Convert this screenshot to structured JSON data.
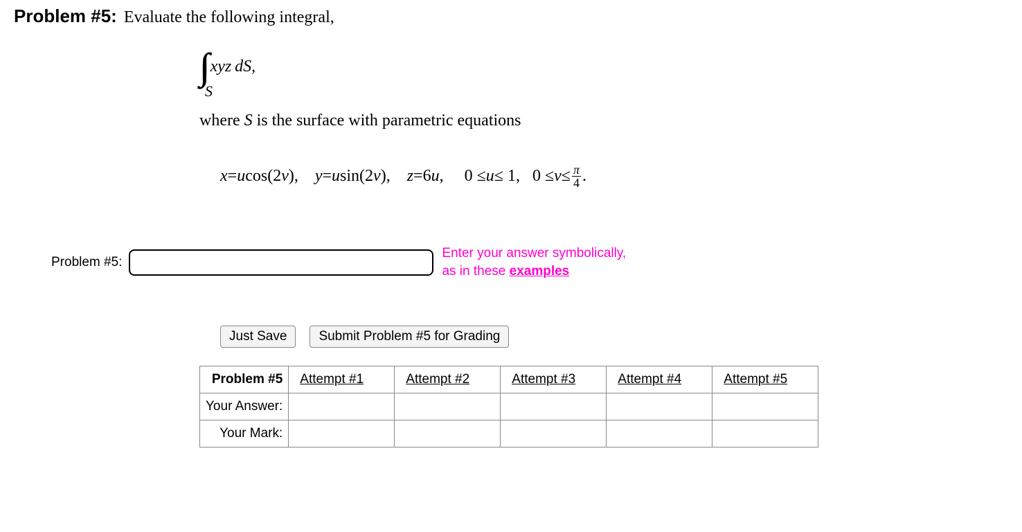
{
  "problem": {
    "number_label": "Problem #5:",
    "instruction": "Evaluate the following integral,",
    "integral": {
      "symbol_sub": "S",
      "integrand_html": "xyz dS,",
      "integrand_vars": "xyz",
      "integrand_dS": "dS",
      "comma": ","
    },
    "where_prefix": "where ",
    "where_S": "S",
    "where_suffix": " is the surface with parametric equations",
    "param": {
      "x_lhs": "x",
      "eq": " = ",
      "u": "u",
      "cos": " cos(2",
      "v": "v",
      "paren_close_comma": "), ",
      "y_lhs": "y",
      "sin": " sin(2",
      "z_lhs": "z",
      "six": "6",
      "range_u": ",  0 ≤ ",
      "leq": " ≤ 1,  0 ≤ ",
      "v2": "v",
      "leq2": " ≤ ",
      "pi": "π",
      "four": "4",
      "period": " ."
    }
  },
  "answer_box": {
    "label": "Problem #5:",
    "value": "",
    "hint_line1": "Enter your answer symbolically,",
    "hint_line2_prefix": "as in these ",
    "hint_link": "examples"
  },
  "buttons": {
    "save": "Just Save",
    "submit": "Submit Problem #5 for Grading"
  },
  "attempts": {
    "header": "Problem #5",
    "row_answer": "Your Answer:",
    "row_mark": "Your Mark:",
    "cols": [
      "Attempt #1",
      "Attempt #2",
      "Attempt #3",
      "Attempt #4",
      "Attempt #5"
    ]
  }
}
